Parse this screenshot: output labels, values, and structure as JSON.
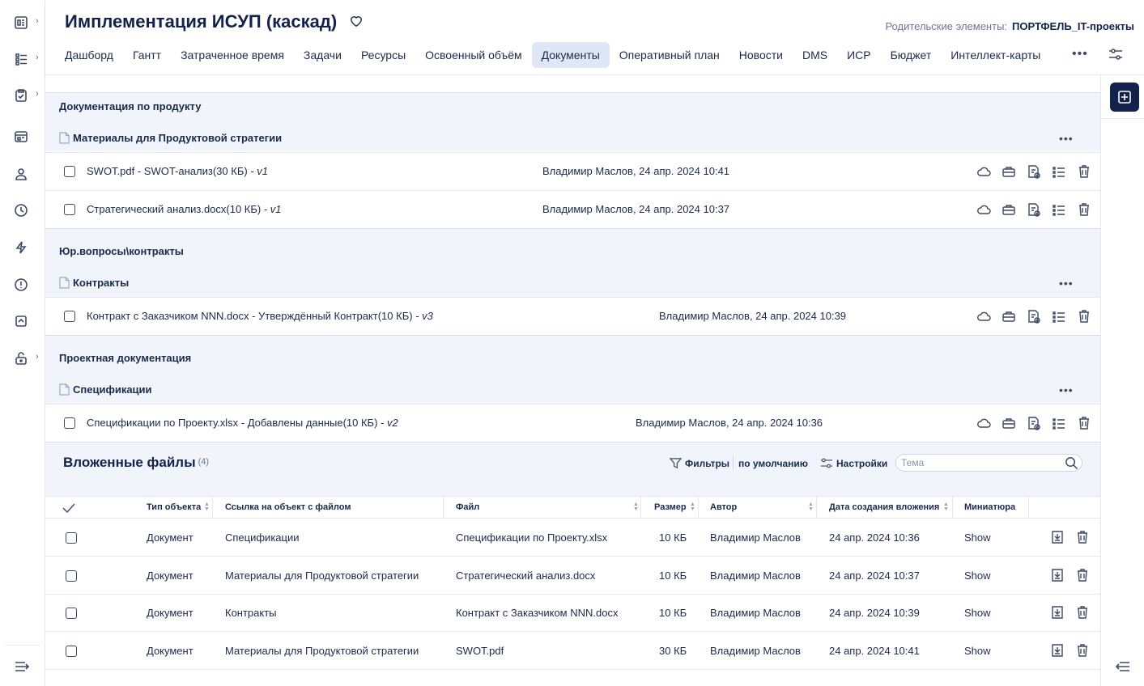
{
  "header": {
    "title": "Имплементация ИСУП (каскад)",
    "parents_label": "Родительские элементы:",
    "parents_value": "ПОРТФЕЛЬ_IT-проекты",
    "tabs": [
      "Дашборд",
      "Гантт",
      "Затраченное время",
      "Задачи",
      "Ресурсы",
      "Освоенный объём",
      "Документы",
      "Оперативный план",
      "Новости",
      "DMS",
      "ИСР",
      "Бюджет",
      "Интеллект-карты"
    ],
    "active_tab": "Документы"
  },
  "sidebar": {
    "icons": [
      "dashboard-icon",
      "list-tree-icon",
      "clipboard-icon",
      "calendar-board-icon",
      "user-icon",
      "clock-icon",
      "lightning-icon",
      "alert-icon",
      "collapse-box-icon",
      "lock-icon"
    ]
  },
  "groups": [
    {
      "title": "Документация по продукту",
      "folder": "Материалы для Продуктовой стратегии",
      "rows": [
        {
          "file": "SWOT.pdf - SWOT-анализ(30 КБ)",
          "version": " - v1",
          "author": "Владимир Маслов, 24 апр. 2024 10:41"
        },
        {
          "file": "Стратегический анализ.docx(10 КБ)",
          "version": " - v1",
          "author": "Владимир Маслов, 24 апр. 2024 10:37"
        }
      ]
    },
    {
      "title": "Юр.вопросы\\контракты",
      "folder": "Контракты",
      "rows": [
        {
          "file": "Контракт с Заказчиком NNN.docx - Утверждённый Контракт(10 КБ)",
          "version": " - v3",
          "author": "Владимир Маслов, 24 апр. 2024 10:39"
        }
      ]
    },
    {
      "title": "Проектная документация",
      "folder": "Спецификации",
      "rows": [
        {
          "file": "Спецификации по Проекту.xlsx - Добавлены данные(10 КБ)",
          "version": " - v2",
          "author": "Владимир Маслов, 24 апр. 2024 10:36"
        }
      ]
    }
  ],
  "attachments": {
    "title": "Вложенные файлы",
    "count": "(4)",
    "filters_label": "Фильтры",
    "filters_default": "по умолчанию",
    "settings_label": "Настройки",
    "search_placeholder": "Тема",
    "columns": [
      "Тип объекта",
      "Ссылка на объект с файлом",
      "Файл",
      "Размер",
      "Автор",
      "Дата создания вложения",
      "Миниатюра"
    ],
    "rows": [
      {
        "type": "Документ",
        "link": "Спецификации",
        "file": "Спецификации по Проекту.xlsx",
        "size": "10 КБ",
        "author": "Владимир Маслов",
        "date": "24 апр. 2024 10:36",
        "thumb": "Show"
      },
      {
        "type": "Документ",
        "link": "Материалы для Продуктовой стратегии",
        "file": "Стратегический анализ.docx",
        "size": "10 КБ",
        "author": "Владимир Маслов",
        "date": "24 апр. 2024 10:37",
        "thumb": "Show"
      },
      {
        "type": "Документ",
        "link": "Контракты",
        "file": "Контракт с Заказчиком NNN.docx",
        "size": "10 КБ",
        "author": "Владимир Маслов",
        "date": "24 апр. 2024 10:39",
        "thumb": "Show"
      },
      {
        "type": "Документ",
        "link": "Материалы для Продуктовой стратегии",
        "file": "SWOT.pdf",
        "size": "30 КБ",
        "author": "Владимир Маслов",
        "date": "24 апр. 2024 10:41",
        "thumb": "Show"
      }
    ]
  },
  "colors": {
    "accent": "#12224a",
    "active_tab_bg": "#dfe6f5",
    "group_bg": "#f1f5fb"
  }
}
